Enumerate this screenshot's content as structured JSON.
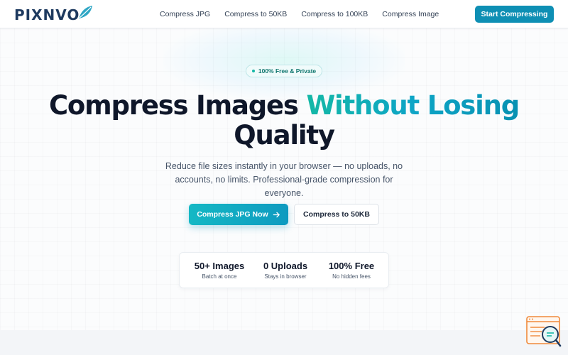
{
  "brand": {
    "name": "PIXNVO"
  },
  "nav": {
    "items": [
      {
        "label": "Compress JPG"
      },
      {
        "label": "Compress to 50KB"
      },
      {
        "label": "Compress to 100KB"
      },
      {
        "label": "Compress Image"
      }
    ],
    "cta_label": "Start Compressing"
  },
  "hero": {
    "badge": "100% Free & Private",
    "title_part1": "Compress Images",
    "title_accent": "Without Losing",
    "title_part2": "Quality",
    "subtitle": "Reduce file sizes instantly in your browser — no uploads, no accounts, no limits. Professional-grade compression for everyone.",
    "primary_button": "Compress JPG Now",
    "secondary_button": "Compress to 50KB"
  },
  "stats": [
    {
      "value": "50+ Images",
      "label": "Batch at once"
    },
    {
      "value": "0 Uploads",
      "label": "Stays in browser"
    },
    {
      "value": "100% Free",
      "label": "No hidden fees"
    }
  ],
  "colors": {
    "brand_navy": "#1e3a5f",
    "accent_teal": "#14b8a6",
    "accent_cyan": "#0891b2",
    "button_blue": "#0e8fb4"
  },
  "icons": {
    "logo": "leaf-icon",
    "primary_button": "arrow-right-icon",
    "badge": "dot-icon",
    "widget": "search-chat-icon"
  }
}
